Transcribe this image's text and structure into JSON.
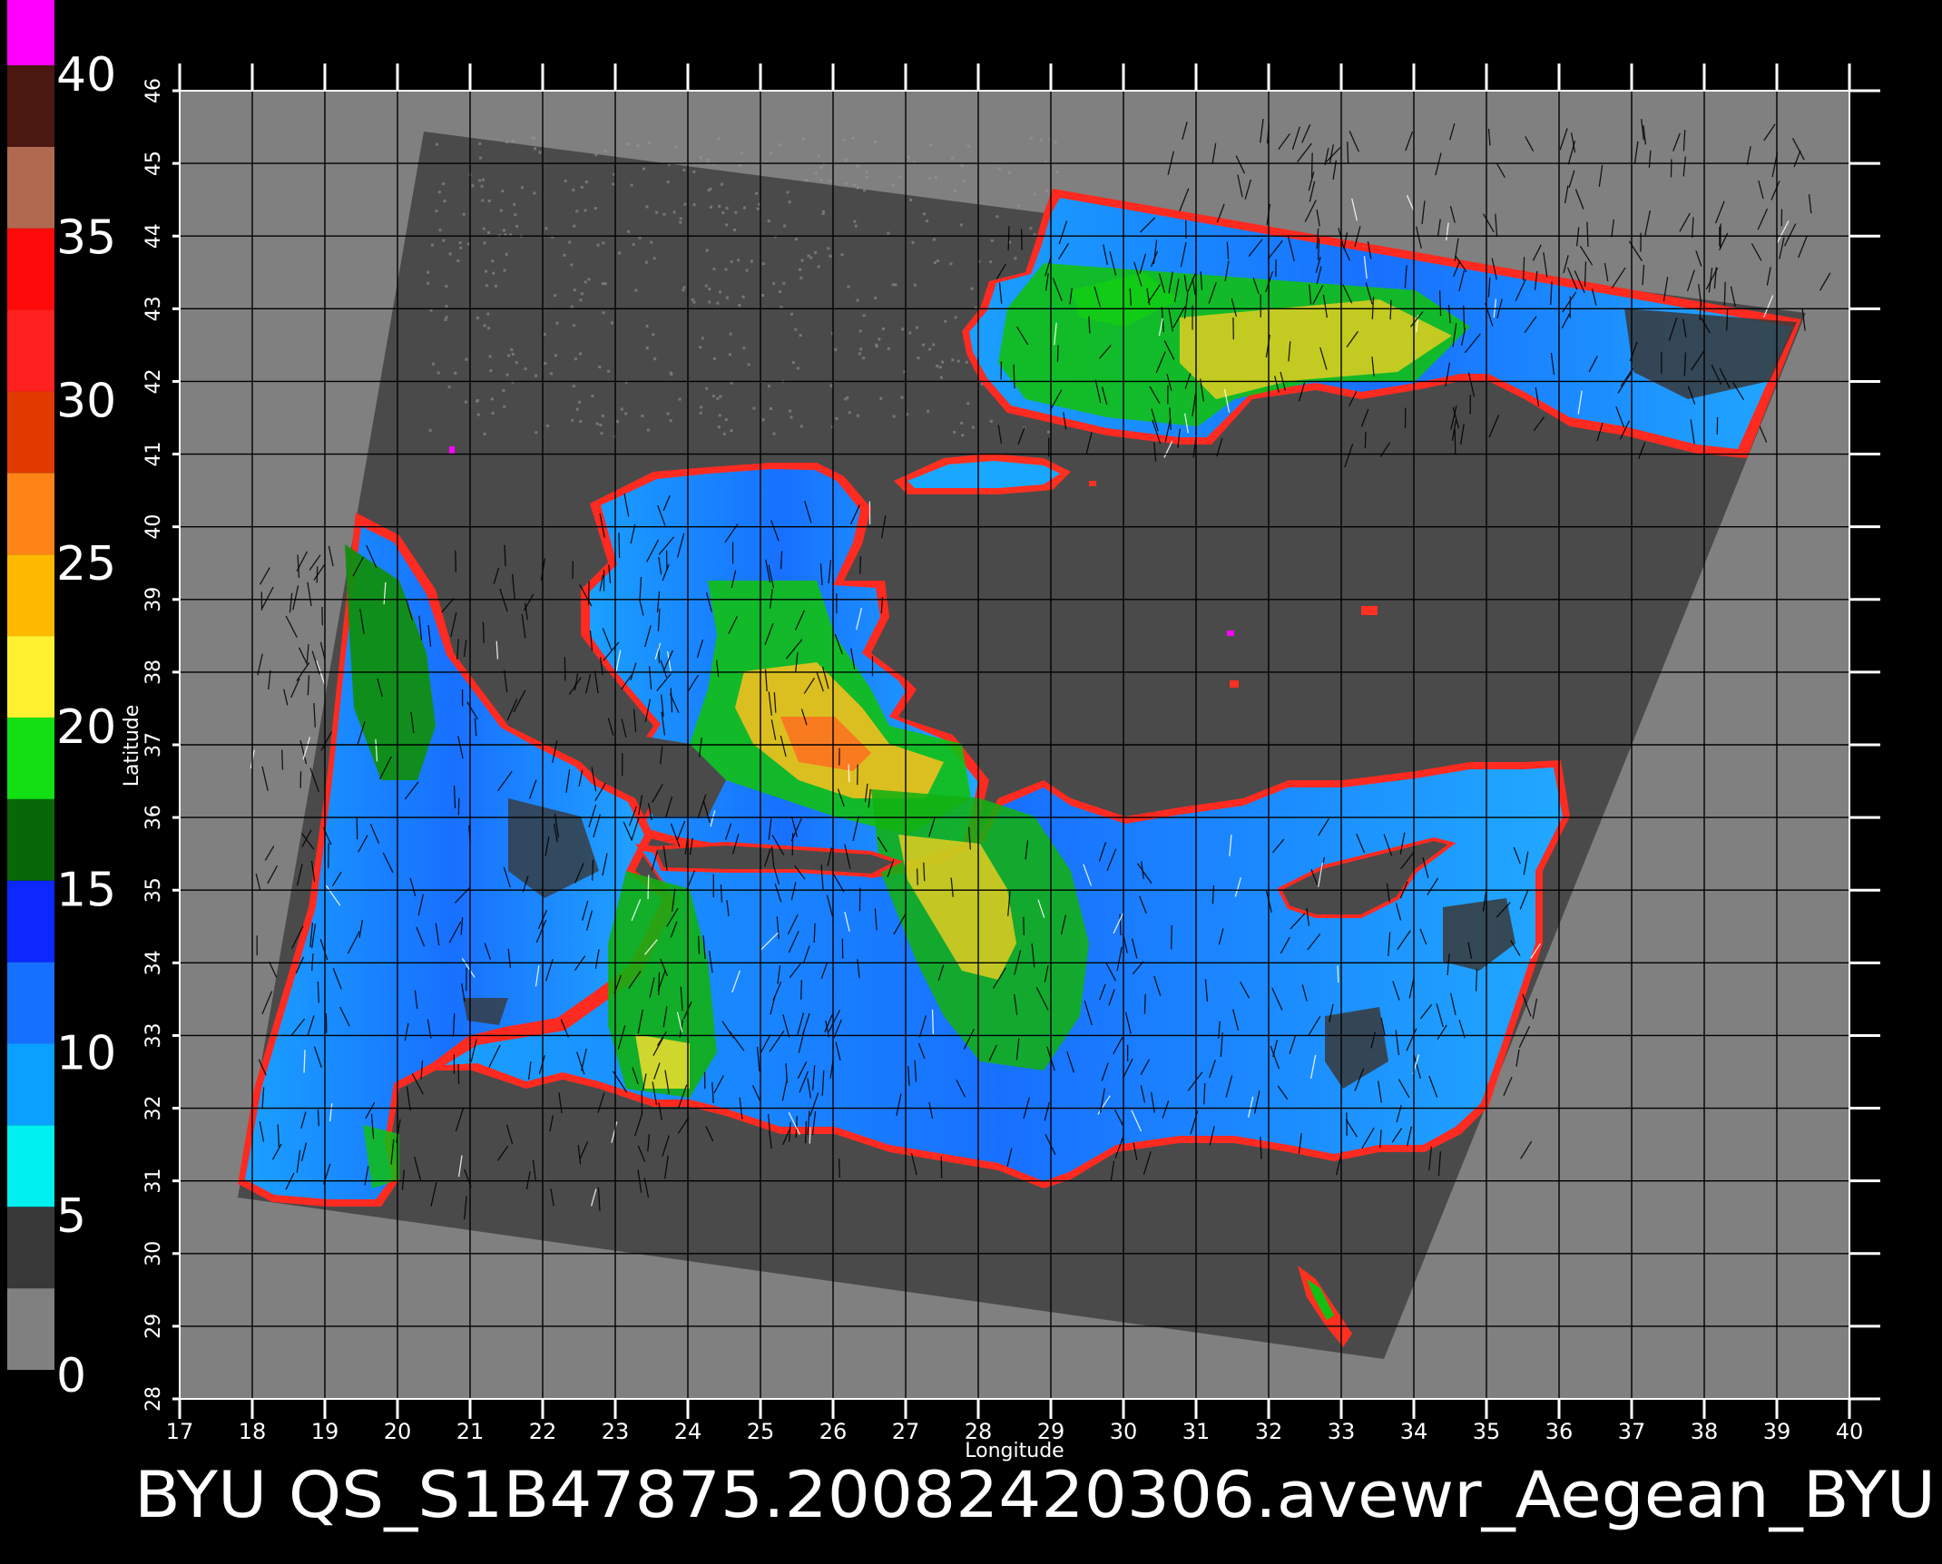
{
  "colorbar": {
    "labels": [
      "0",
      "5",
      "10",
      "15",
      "20",
      "25",
      "30",
      "35",
      "40"
    ],
    "min": 0,
    "max": 40,
    "segments": [
      {
        "from": 0,
        "to": 2.5,
        "color": "#808080"
      },
      {
        "from": 2.5,
        "to": 5,
        "color": "#383838"
      },
      {
        "from": 5,
        "to": 7.5,
        "color": "#00f0f0"
      },
      {
        "from": 7.5,
        "to": 10,
        "color": "#0aa0ff"
      },
      {
        "from": 10,
        "to": 12.5,
        "color": "#1670ff"
      },
      {
        "from": 12.5,
        "to": 15,
        "color": "#0a28ff"
      },
      {
        "from": 15,
        "to": 17.5,
        "color": "#086808"
      },
      {
        "from": 17.5,
        "to": 20,
        "color": "#12e012"
      },
      {
        "from": 20,
        "to": 22.5,
        "color": "#fff030"
      },
      {
        "from": 22.5,
        "to": 25,
        "color": "#ffb800"
      },
      {
        "from": 25,
        "to": 27.5,
        "color": "#ff8418"
      },
      {
        "from": 27.5,
        "to": 30,
        "color": "#e03a00"
      },
      {
        "from": 30,
        "to": 32.5,
        "color": "#ff2020"
      },
      {
        "from": 32.5,
        "to": 35,
        "color": "#ff0a0a"
      },
      {
        "from": 35,
        "to": 37.5,
        "color": "#b06a50"
      },
      {
        "from": 37.5,
        "to": 40,
        "color": "#4a1810"
      },
      {
        "from": 40,
        "to": 42,
        "color": "#ff00ff"
      }
    ]
  },
  "map": {
    "xlabel": "Longitude",
    "ylabel": "Latitude",
    "lon_ticks": [
      "17",
      "18",
      "19",
      "20",
      "21",
      "22",
      "23",
      "24",
      "25",
      "26",
      "27",
      "28",
      "29",
      "30",
      "31",
      "32",
      "33",
      "34",
      "35",
      "36",
      "37",
      "38",
      "39",
      "40"
    ],
    "lat_ticks": [
      "28",
      "29",
      "30",
      "31",
      "32",
      "33",
      "34",
      "35",
      "36",
      "37",
      "38",
      "39",
      "40",
      "41",
      "42",
      "43",
      "44",
      "45",
      "46"
    ],
    "lon_range": [
      17,
      40
    ],
    "lat_range": [
      28,
      46
    ],
    "colors": {
      "background": "#808080",
      "swath": "#4a4a4a",
      "grid": "#000000",
      "ocean_low": "#1aa0ff",
      "ocean_mid": "#1660ff",
      "ocean_high": "#12d012",
      "ocean_peak": "#ffe030",
      "coast": "#ff2020"
    }
  },
  "footer": {
    "title": "BYU  QS_S1B47875.20082420306.avewr_Aegean_BYU"
  }
}
